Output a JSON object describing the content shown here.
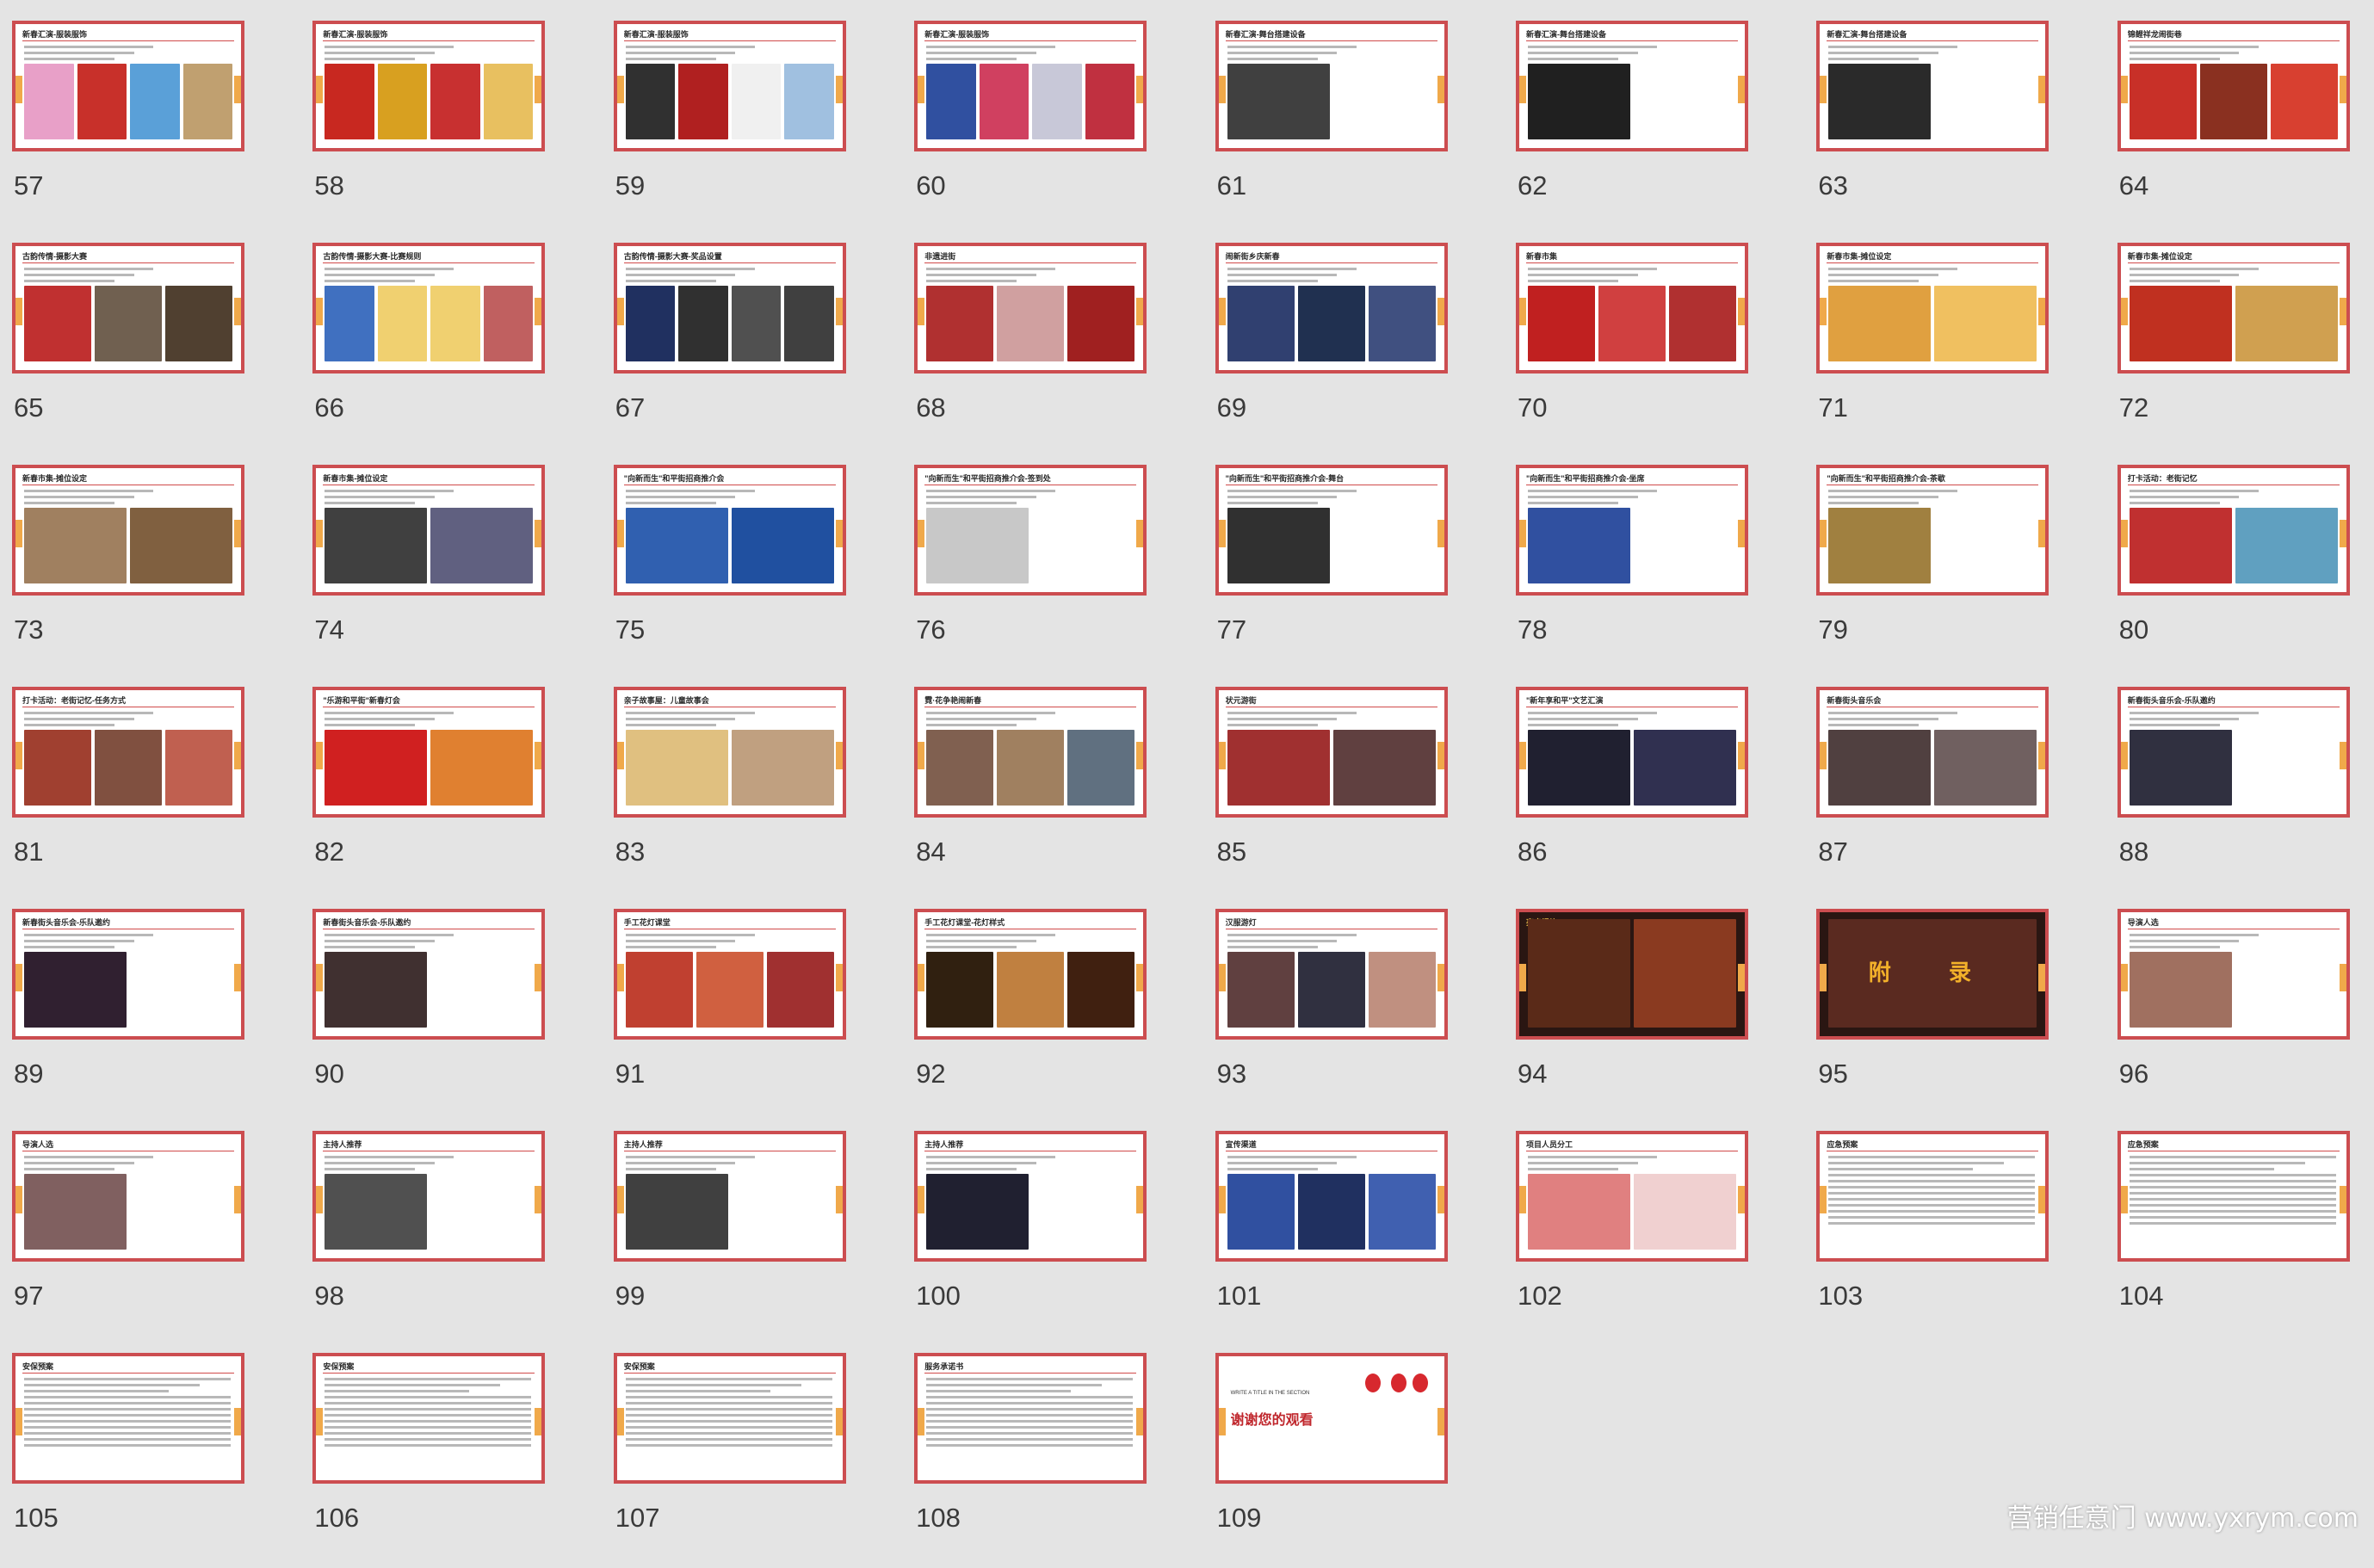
{
  "colors": {
    "background": "#e4e4e4",
    "slide_border": "#cc4d50",
    "side_tab": "#f0a94a",
    "slide_number": "#3a3a3a",
    "title_accent": "#d04a4a"
  },
  "slides": [
    {
      "number": "57",
      "title": "新春汇演-服装服饰",
      "kind": "images",
      "palette": [
        "#e8a0c8",
        "#c8302a",
        "#5aa0d8",
        "#c0a070"
      ]
    },
    {
      "number": "58",
      "title": "新春汇演-服装服饰",
      "kind": "images",
      "palette": [
        "#c82820",
        "#d8a020",
        "#c83030",
        "#e8c060"
      ]
    },
    {
      "number": "59",
      "title": "新春汇演-服装服饰",
      "kind": "images",
      "palette": [
        "#303030",
        "#b02020",
        "#f0f0f0",
        "#a0c0e0"
      ]
    },
    {
      "number": "60",
      "title": "新春汇演-服装服饰",
      "kind": "images",
      "palette": [
        "#3050a0",
        "#d04060",
        "#c8c8d8",
        "#c03040"
      ]
    },
    {
      "number": "61",
      "title": "新春汇演-舞台搭建设备",
      "kind": "images",
      "palette": [
        "#404040",
        "#ffffff"
      ]
    },
    {
      "number": "62",
      "title": "新春汇演-舞台搭建设备",
      "kind": "images",
      "palette": [
        "#202020",
        "#ffffff"
      ]
    },
    {
      "number": "63",
      "title": "新春汇演-舞台搭建设备",
      "kind": "images",
      "palette": [
        "#2a2a2a",
        "#ffffff"
      ]
    },
    {
      "number": "64",
      "title": "锦鲤祥龙闹街巷",
      "kind": "images",
      "palette": [
        "#c83028",
        "#8a3020",
        "#d84030"
      ]
    },
    {
      "number": "65",
      "title": "古韵传情-摄影大赛",
      "kind": "images",
      "palette": [
        "#c03030",
        "#706050",
        "#504030"
      ]
    },
    {
      "number": "66",
      "title": "古韵传情-摄影大赛-比赛规则",
      "kind": "images",
      "palette": [
        "#4070c0",
        "#f0d070",
        "#f0d070",
        "#c06060"
      ]
    },
    {
      "number": "67",
      "title": "古韵传情-摄影大赛-奖品设置",
      "kind": "images",
      "palette": [
        "#203060",
        "#303030",
        "#505050",
        "#404040"
      ]
    },
    {
      "number": "68",
      "title": "非遗进街",
      "kind": "images",
      "palette": [
        "#b03030",
        "#d0a0a0",
        "#a02020"
      ]
    },
    {
      "number": "69",
      "title": "闹新街乡庆新春",
      "kind": "images",
      "palette": [
        "#304070",
        "#203050",
        "#405080"
      ]
    },
    {
      "number": "70",
      "title": "新春市集",
      "kind": "images",
      "palette": [
        "#c02020",
        "#d04040",
        "#b03030"
      ]
    },
    {
      "number": "71",
      "title": "新春市集-摊位设定",
      "kind": "images",
      "palette": [
        "#e0a040",
        "#f0c060"
      ]
    },
    {
      "number": "72",
      "title": "新春市集-摊位设定",
      "kind": "images",
      "palette": [
        "#c03020",
        "#d0a050"
      ]
    },
    {
      "number": "73",
      "title": "新春市集-摊位设定",
      "kind": "images",
      "palette": [
        "#a08060",
        "#806040"
      ]
    },
    {
      "number": "74",
      "title": "新春市集-摊位设定",
      "kind": "images",
      "palette": [
        "#404040",
        "#606080"
      ]
    },
    {
      "number": "75",
      "title": "\"向新而生\"和平街招商推介会",
      "kind": "images",
      "palette": [
        "#3060b0",
        "#2050a0"
      ]
    },
    {
      "number": "76",
      "title": "\"向新而生\"和平街招商推介会-签到处",
      "kind": "images",
      "palette": [
        "#c8c8c8",
        "#ffffff"
      ]
    },
    {
      "number": "77",
      "title": "\"向新而生\"和平街招商推介会-舞台",
      "kind": "images",
      "palette": [
        "#303030",
        "#ffffff"
      ]
    },
    {
      "number": "78",
      "title": "\"向新而生\"和平街招商推介会-坐席",
      "kind": "images",
      "palette": [
        "#3050a0",
        "#ffffff"
      ]
    },
    {
      "number": "79",
      "title": "\"向新而生\"和平街招商推介会-茶歇",
      "kind": "images",
      "palette": [
        "#a08040",
        "#ffffff"
      ]
    },
    {
      "number": "80",
      "title": "打卡活动：老街记忆",
      "kind": "images",
      "palette": [
        "#c03030",
        "#60a0c0"
      ]
    },
    {
      "number": "81",
      "title": "打卡活动：老街记忆-任务方式",
      "kind": "images",
      "palette": [
        "#a04030",
        "#805040",
        "#c06050"
      ]
    },
    {
      "number": "82",
      "title": "\"乐游和平街\"新春灯会",
      "kind": "images",
      "palette": [
        "#d02020",
        "#e08030"
      ]
    },
    {
      "number": "83",
      "title": "亲子故事屋：儿童故事会",
      "kind": "images",
      "palette": [
        "#e0c080",
        "#c0a080"
      ]
    },
    {
      "number": "84",
      "title": "霓·花争艳闹新春",
      "kind": "images",
      "palette": [
        "#806050",
        "#a08060",
        "#607080"
      ]
    },
    {
      "number": "85",
      "title": "状元游街",
      "kind": "images",
      "palette": [
        "#a03030",
        "#604040"
      ]
    },
    {
      "number": "86",
      "title": "\"新年享和平\"文艺汇演",
      "kind": "images",
      "palette": [
        "#202030",
        "#303050"
      ]
    },
    {
      "number": "87",
      "title": "新春街头音乐会",
      "kind": "images",
      "palette": [
        "#504040",
        "#706060"
      ]
    },
    {
      "number": "88",
      "title": "新春街头音乐会-乐队邀约",
      "kind": "images",
      "palette": [
        "#303040",
        "#ffffff"
      ]
    },
    {
      "number": "89",
      "title": "新春街头音乐会-乐队邀约",
      "kind": "images",
      "palette": [
        "#302030",
        "#ffffff"
      ]
    },
    {
      "number": "90",
      "title": "新春街头音乐会-乐队邀约",
      "kind": "images",
      "palette": [
        "#403030",
        "#ffffff"
      ]
    },
    {
      "number": "91",
      "title": "手工花灯课堂",
      "kind": "images",
      "palette": [
        "#c04030",
        "#d06040",
        "#a03030"
      ]
    },
    {
      "number": "92",
      "title": "手工花灯课堂-花灯样式",
      "kind": "images",
      "palette": [
        "#302010",
        "#c08040",
        "#402010"
      ]
    },
    {
      "number": "93",
      "title": "汉服游灯",
      "kind": "images",
      "palette": [
        "#604040",
        "#303040",
        "#c09080"
      ]
    },
    {
      "number": "94",
      "title": "亮点提炼",
      "kind": "dark",
      "palette": [
        "#5a2a18",
        "#8a3a20"
      ]
    },
    {
      "number": "95",
      "title": "",
      "kind": "appendix",
      "big_text": "附 录",
      "palette": [
        "#5a2a20"
      ]
    },
    {
      "number": "96",
      "title": "导演人选",
      "kind": "images",
      "palette": [
        "#a07060",
        "#ffffff"
      ]
    },
    {
      "number": "97",
      "title": "导演人选",
      "kind": "images",
      "palette": [
        "#806060",
        "#ffffff"
      ]
    },
    {
      "number": "98",
      "title": "主持人推荐",
      "kind": "images",
      "palette": [
        "#505050",
        "#ffffff"
      ]
    },
    {
      "number": "99",
      "title": "主持人推荐",
      "kind": "images",
      "palette": [
        "#404040",
        "#ffffff"
      ]
    },
    {
      "number": "100",
      "title": "主持人推荐",
      "kind": "images",
      "palette": [
        "#202030",
        "#ffffff"
      ]
    },
    {
      "number": "101",
      "title": "宣传渠道",
      "kind": "images",
      "palette": [
        "#3050a0",
        "#203060",
        "#4060b0"
      ]
    },
    {
      "number": "102",
      "title": "项目人员分工",
      "kind": "table",
      "palette": [
        "#e08080",
        "#f0d0d0"
      ]
    },
    {
      "number": "103",
      "title": "应急预案",
      "kind": "text",
      "palette": [
        "#ffffff"
      ]
    },
    {
      "number": "104",
      "title": "应急预案",
      "kind": "text",
      "palette": [
        "#ffffff"
      ]
    },
    {
      "number": "105",
      "title": "安保预案",
      "kind": "text",
      "palette": [
        "#ffffff"
      ]
    },
    {
      "number": "106",
      "title": "安保预案",
      "kind": "text",
      "palette": [
        "#ffffff"
      ]
    },
    {
      "number": "107",
      "title": "安保预案",
      "kind": "text",
      "palette": [
        "#ffffff"
      ]
    },
    {
      "number": "108",
      "title": "服务承诺书",
      "kind": "text",
      "palette": [
        "#ffffff"
      ]
    },
    {
      "number": "109",
      "title": "",
      "kind": "thanks",
      "sub_text": "WRITE A TITLE IN THE SECTION",
      "big_text": "谢谢您的观看",
      "palette": [
        "#ffffff"
      ]
    }
  ],
  "watermark": "营销任意门 www.yxrym.com"
}
